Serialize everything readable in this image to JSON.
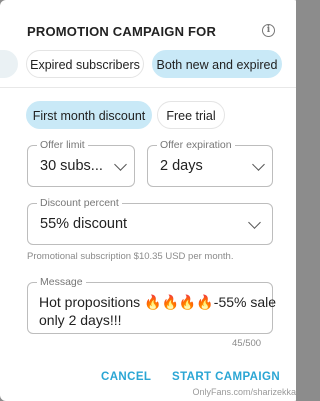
{
  "dialog": {
    "title": "PROMOTION CAMPAIGN FOR",
    "info_icon": "info-icon",
    "audience_chips": [
      {
        "label": "Expired subscribers",
        "selected": false
      },
      {
        "label": "Both new and expired",
        "selected": true
      }
    ],
    "offer_type_chips": [
      {
        "label": "First month discount",
        "selected": true
      },
      {
        "label": "Free trial",
        "selected": false
      }
    ],
    "offer_limit": {
      "label": "Offer limit",
      "value": "30 subs..."
    },
    "offer_expiration": {
      "label": "Offer expiration",
      "value": "2 days"
    },
    "discount_percent": {
      "label": "Discount percent",
      "value": "55% discount"
    },
    "hint": "Promotional subscription $10.35 USD per month.",
    "message": {
      "label": "Message",
      "value": "Hot propositions 🔥🔥🔥🔥-55% sale only 2 days!!!"
    },
    "counter": "45/500",
    "cancel_label": "CANCEL",
    "start_label": "START CAMPAIGN"
  },
  "watermark": "OnlyFans.com/sharizekka",
  "colors": {
    "accent": "#2aa6d4",
    "chip_selected": "#c9e9f7",
    "overlay": "#8c8c8c"
  }
}
